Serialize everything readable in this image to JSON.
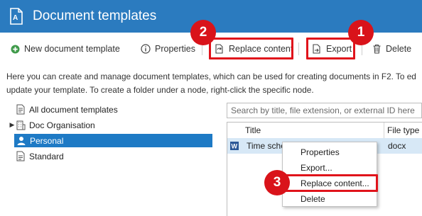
{
  "window": {
    "title": "Document templates"
  },
  "toolbar": {
    "new_label": "New document template",
    "properties_label": "Properties",
    "replace_label": "Replace content",
    "export_label": "Export",
    "delete_label": "Delete"
  },
  "description": {
    "line1": "Here you can create and manage document templates, which can be used for creating documents in F2. To ed",
    "line2": "update your template. To create a folder under a node, right-click the specific node."
  },
  "tree": {
    "items": [
      {
        "label": "All document templates",
        "icon": "document-list-icon",
        "expandable": false,
        "selected": false
      },
      {
        "label": "Doc Organisation",
        "icon": "building-icon",
        "expandable": true,
        "selected": false
      },
      {
        "label": "Personal",
        "icon": "person-icon",
        "expandable": false,
        "selected": true
      },
      {
        "label": "Standard",
        "icon": "document-icon",
        "expandable": false,
        "selected": false
      }
    ]
  },
  "search": {
    "placeholder": "Search by title, file extension, or external ID here"
  },
  "grid": {
    "columns": [
      "Title",
      "File type"
    ],
    "rows": [
      {
        "title": "Time sched...",
        "file_type": "docx",
        "icon": "word-doc-icon"
      }
    ]
  },
  "context_menu": {
    "items": [
      "Properties",
      "Export...",
      "Replace content...",
      "Delete"
    ]
  },
  "annotations": {
    "badges": [
      "1",
      "2",
      "3"
    ],
    "highlight_color": "#e0131b"
  },
  "colors": {
    "titlebar": "#2b7bbf",
    "selection": "#1e7ac5",
    "row_highlight": "#d7e8f6"
  }
}
